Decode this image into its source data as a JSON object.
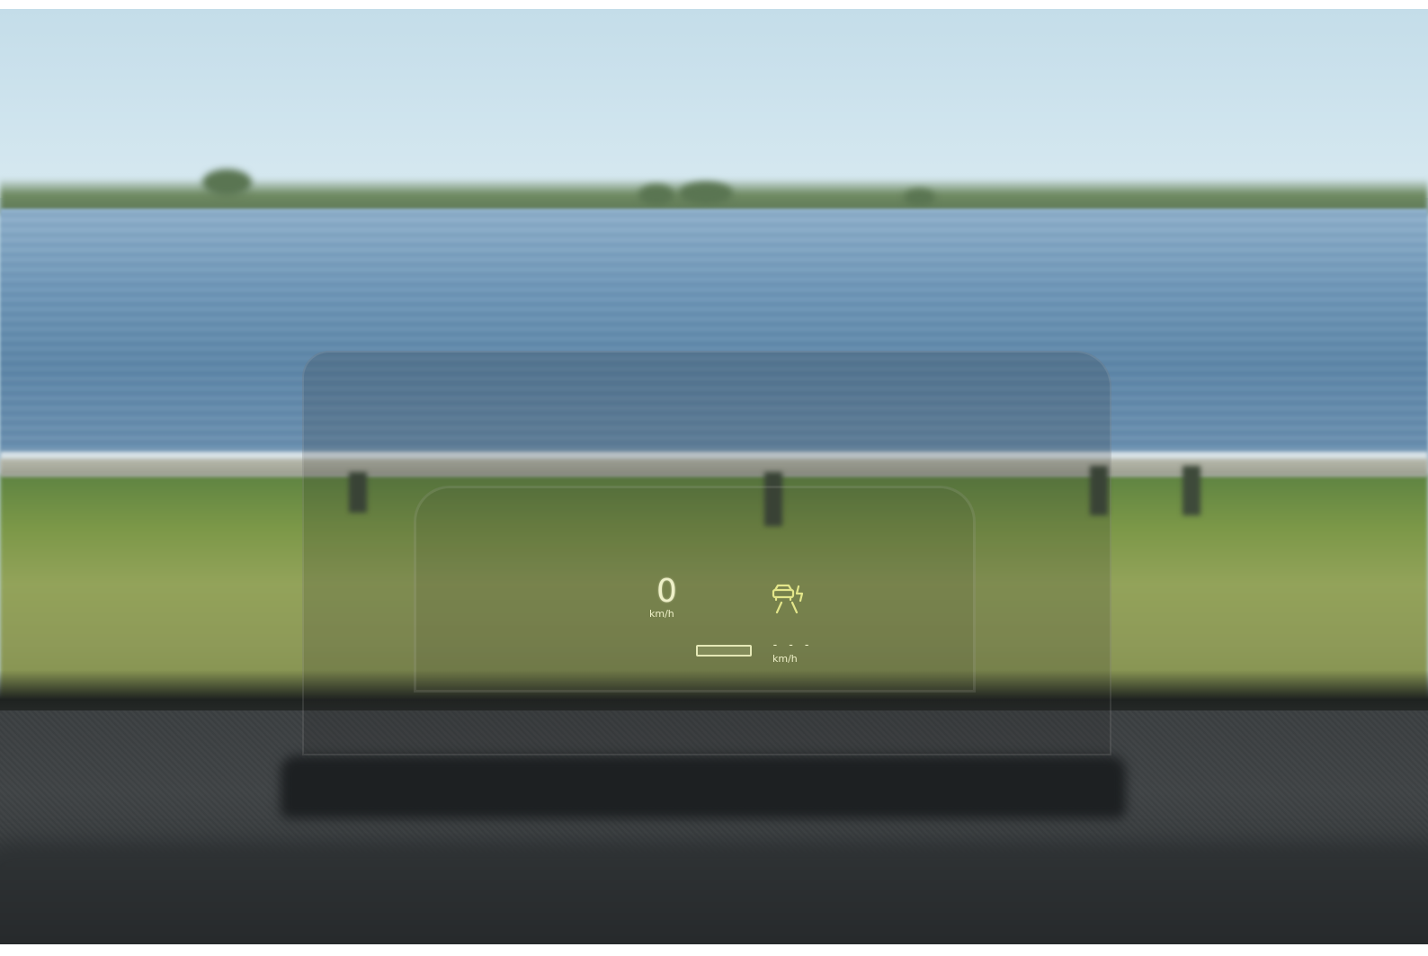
{
  "hud": {
    "speed_value": "0",
    "speed_unit": "km/h",
    "set_speed_value": "- - -",
    "set_speed_unit": "km/h",
    "icon": "lane-assist-car-icon",
    "color": "#e6e9a8"
  },
  "scene": {
    "sky_color": "#cfe4ee",
    "water_color": "#6f97b8",
    "grass_color": "#8e9a58",
    "dashboard_color": "#3b3f41"
  }
}
